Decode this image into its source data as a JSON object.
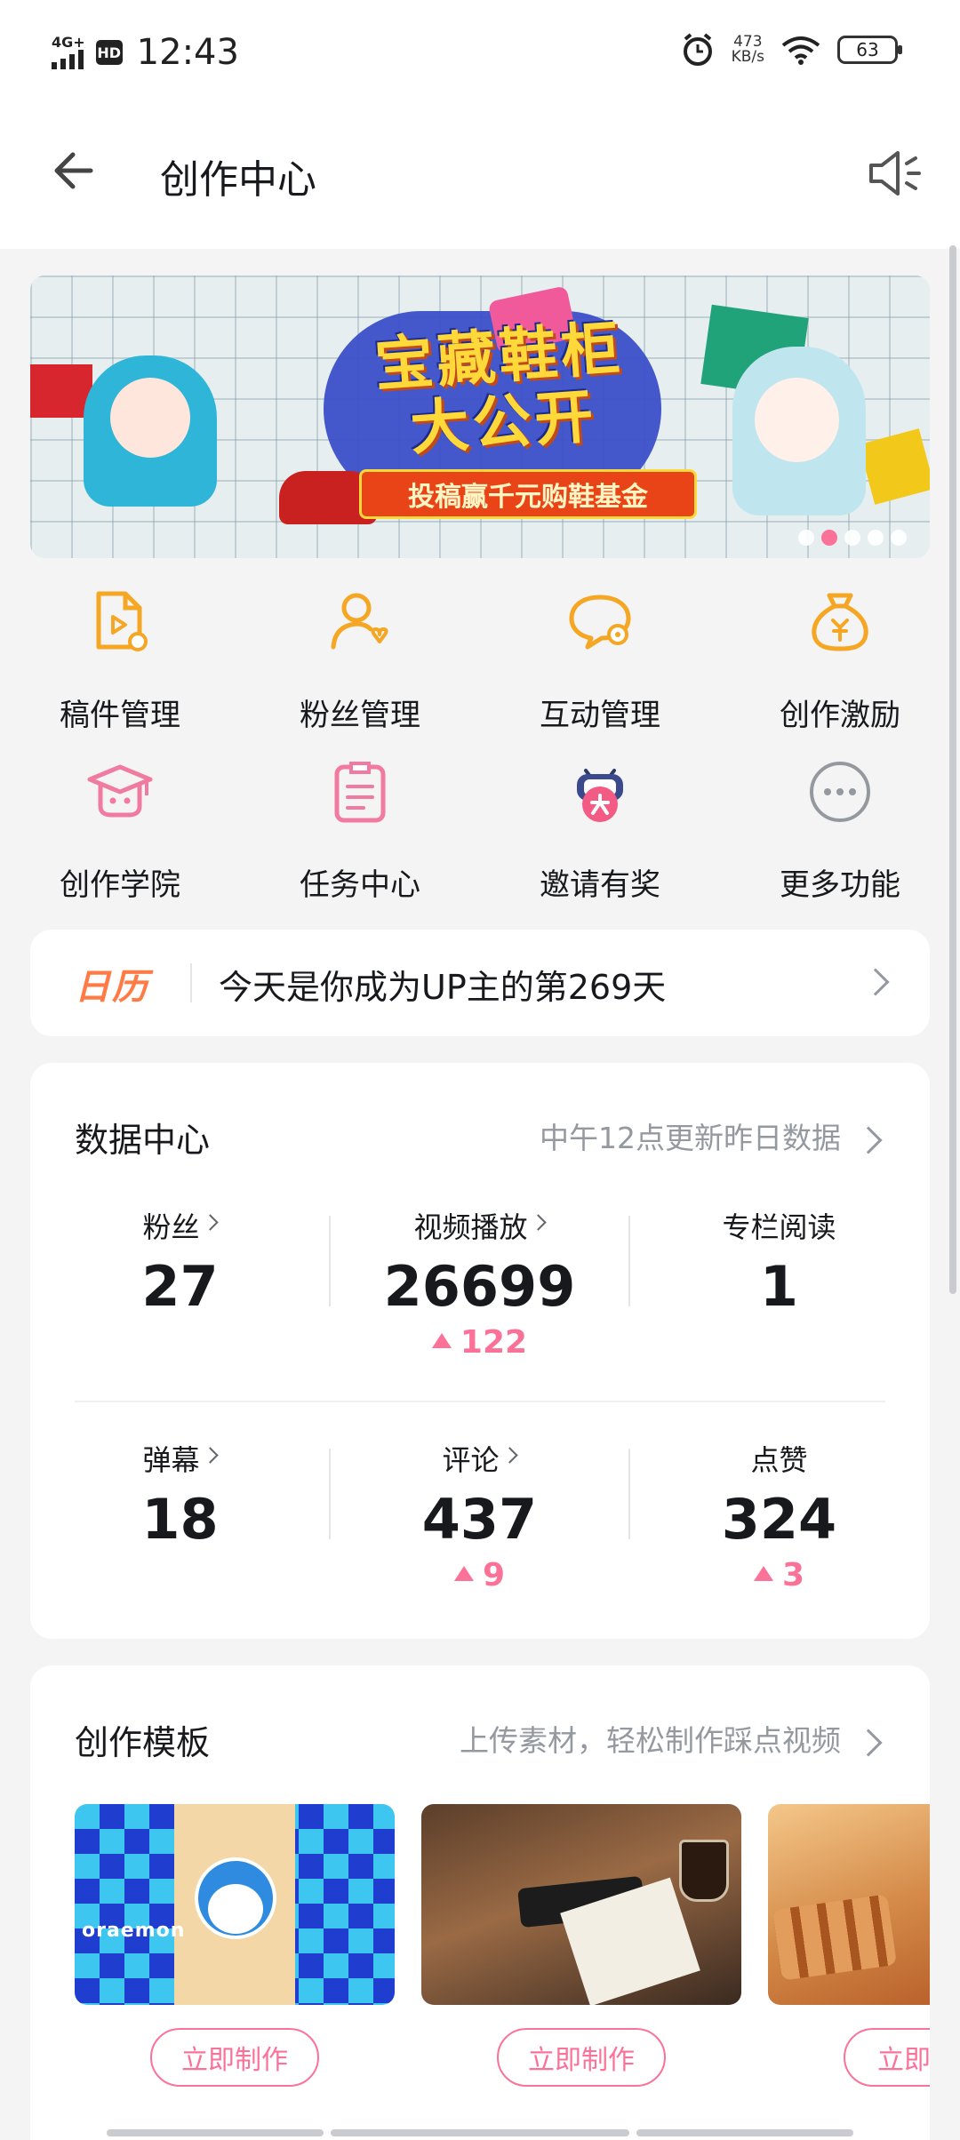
{
  "status_bar": {
    "network": "4G+",
    "hd": "HD",
    "time": "12:43",
    "speed_value": "473",
    "speed_unit": "KB/s",
    "battery": "63"
  },
  "header": {
    "title": "创作中心",
    "back_icon": "back-arrow-icon",
    "speaker_icon": "speaker-icon"
  },
  "banner": {
    "title_line1": "宝藏鞋柜",
    "title_line2": "大公开",
    "subtitle": "投稿赢千元购鞋基金",
    "slide_count": 5,
    "active_slide": 2
  },
  "functions": [
    {
      "label": "稿件管理",
      "icon": "manuscript-icon",
      "color": "#f5a623"
    },
    {
      "label": "粉丝管理",
      "icon": "fans-icon",
      "color": "#f5a623"
    },
    {
      "label": "互动管理",
      "icon": "interaction-icon",
      "color": "#f5a623"
    },
    {
      "label": "创作激励",
      "icon": "money-bag-icon",
      "color": "#f5a623"
    },
    {
      "label": "创作学院",
      "icon": "graduation-cap-icon",
      "color": "#f07aa0"
    },
    {
      "label": "任务中心",
      "icon": "task-clipboard-icon",
      "color": "#f07aa0"
    },
    {
      "label": "邀请有奖",
      "icon": "invite-reward-icon",
      "color": "#f07aa0"
    },
    {
      "label": "更多功能",
      "icon": "more-dots-icon",
      "color": "#9499a0"
    }
  ],
  "calendar": {
    "tag": "日历",
    "text": "今天是你成为UP主的第269天"
  },
  "data_center": {
    "title": "数据中心",
    "note": "中午12点更新昨日数据",
    "stats": [
      {
        "label": "粉丝",
        "value": "27",
        "delta": "",
        "has_arrow": true
      },
      {
        "label": "视频播放",
        "value": "26699",
        "delta": "122",
        "has_arrow": true
      },
      {
        "label": "专栏阅读",
        "value": "1",
        "delta": "",
        "has_arrow": false
      },
      {
        "label": "弹幕",
        "value": "18",
        "delta": "",
        "has_arrow": true
      },
      {
        "label": "评论",
        "value": "437",
        "delta": "9",
        "has_arrow": true
      },
      {
        "label": "点赞",
        "value": "324",
        "delta": "3",
        "has_arrow": false
      }
    ]
  },
  "templates": {
    "title": "创作模板",
    "note": "上传素材，轻松制作踩点视频",
    "thumb_text": "oraemon",
    "button_label": "立即制作",
    "button_label_partial": "立即"
  },
  "colors": {
    "accent_pink": "#fb7299",
    "accent_orange": "#ff7a45",
    "icon_yellow": "#f5a623"
  }
}
